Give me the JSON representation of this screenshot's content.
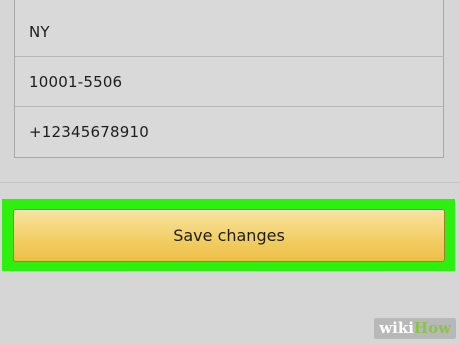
{
  "form": {
    "fields": [
      {
        "value": "NY"
      },
      {
        "value": "10001-5506"
      },
      {
        "value": "+12345678910"
      }
    ]
  },
  "actions": {
    "save_label": "Save changes"
  },
  "watermark": {
    "part1": "wiki",
    "part2": "How"
  },
  "colors": {
    "highlight": "#2ef00e",
    "button_gradient_top": "#f8e3a0",
    "button_gradient_bottom": "#eebe46",
    "background": "#d6d6d6"
  }
}
